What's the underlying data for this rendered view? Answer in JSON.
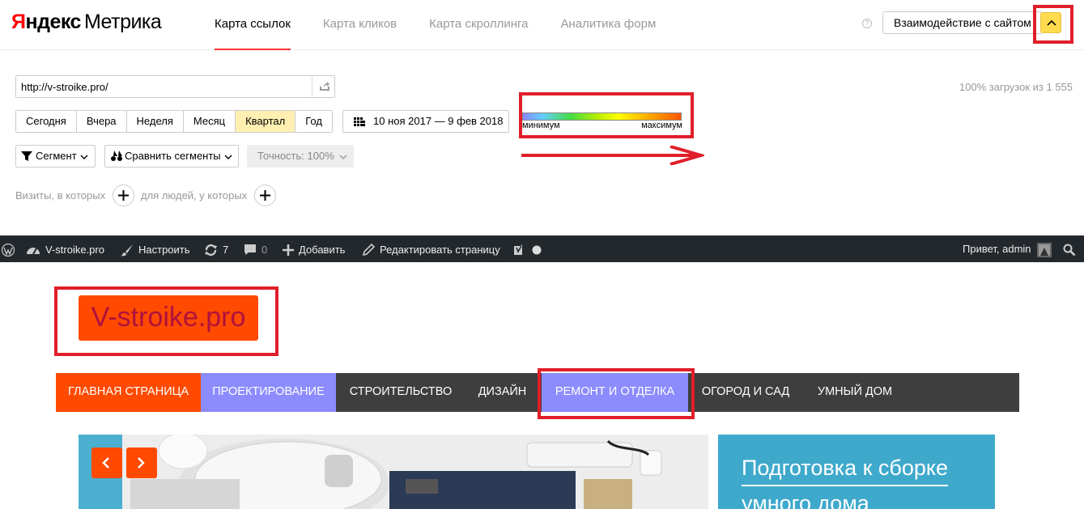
{
  "metrika": {
    "logo": {
      "first_letter": "Я",
      "brand_rest": "ндекс",
      "product": "Метрика"
    },
    "tabs": [
      {
        "label": "Карта ссылок",
        "active": true
      },
      {
        "label": "Карта кликов",
        "active": false
      },
      {
        "label": "Карта скроллинга",
        "active": false
      },
      {
        "label": "Аналитика форм",
        "active": false
      }
    ],
    "interact_button": "Взаимодействие с сайтом",
    "url_value": "http://v-stroike.pro/",
    "load_info": "100% загрузок из 1 555",
    "periods": [
      {
        "label": "Сегодня",
        "active": false
      },
      {
        "label": "Вчера",
        "active": false
      },
      {
        "label": "Неделя",
        "active": false
      },
      {
        "label": "Месяц",
        "active": false
      },
      {
        "label": "Квартал",
        "active": true
      },
      {
        "label": "Год",
        "active": false
      }
    ],
    "date_range": "10 ноя 2017 — 9 фев 2018",
    "legend": {
      "min_label": "минимум",
      "max_label": "максимум"
    },
    "segment_button": "Сегмент",
    "compare_button": "Сравнить сегменты",
    "precision": "Точность:  100%",
    "visits_label": "Визиты, в которых",
    "people_label": "для людей, у которых",
    "accent_color": "#ffdb4d",
    "highlight_color": "#e01f2a"
  },
  "wp_bar": {
    "site_name": "V-stroike.pro",
    "customize": "Настроить",
    "updates_count": "7",
    "comments_count": "0",
    "add_new": "Добавить",
    "edit_page": "Редактировать страницу",
    "greeting": "Привет, admin"
  },
  "site": {
    "logo_text": "V-stroike.pro",
    "nav": [
      {
        "label": "Главная страница"
      },
      {
        "label": "Проектирование"
      },
      {
        "label": "Строительство"
      },
      {
        "label": "Дизайн"
      },
      {
        "label": "Ремонт и отделка"
      },
      {
        "label": "Огород и сад"
      },
      {
        "label": "Умный дом"
      }
    ],
    "side_title_line1": "Подготовка к сборке",
    "side_title_line2": "умного дома",
    "brand_color": "#ff4a00",
    "nav_bg_color": "#3e3e3e",
    "panel_color": "#3fa9cc"
  }
}
